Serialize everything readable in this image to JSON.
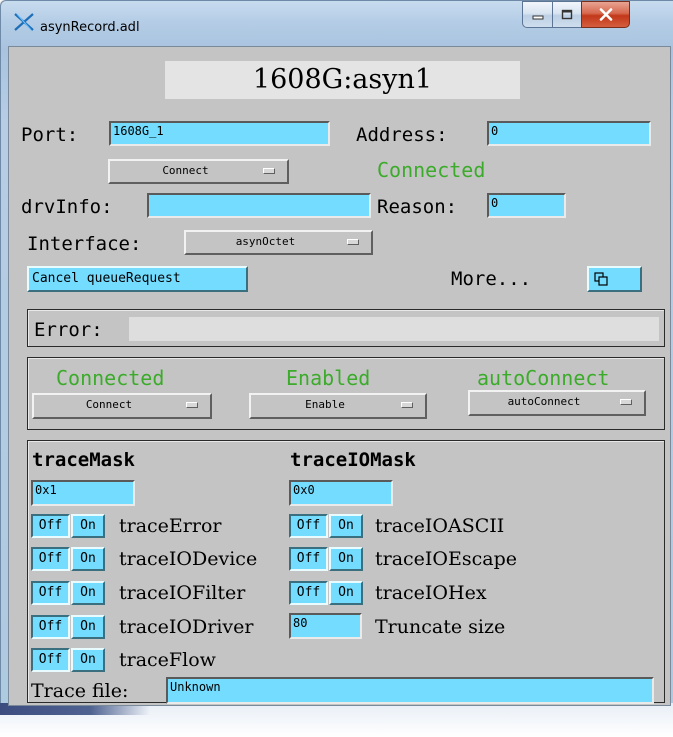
{
  "window": {
    "title": "asynRecord.adl",
    "controls": {
      "minimize": "minimize-icon",
      "maximize": "maximize-icon",
      "close": "close-icon"
    },
    "accent": "#73dcff"
  },
  "record": {
    "name": "1608G:asyn1"
  },
  "port": {
    "label": "Port:",
    "value": "1608G_1"
  },
  "address": {
    "label": "Address:",
    "value": "0"
  },
  "connect_menu": {
    "value": "Connect"
  },
  "connection_status": {
    "text": "Connected",
    "color": "#3cab2b"
  },
  "drvinfo": {
    "label": "drvInfo:",
    "value": ""
  },
  "reason": {
    "label": "Reason:",
    "value": "0"
  },
  "interface": {
    "label": "Interface:",
    "value": "asynOctet"
  },
  "cancel_button": {
    "label": "Cancel queueRequest"
  },
  "more": {
    "label": "More...",
    "icon": "related-display-icon"
  },
  "error": {
    "label": "Error:",
    "value": ""
  },
  "status_panel": {
    "connected": {
      "status": "Connected",
      "menu_value": "Connect"
    },
    "enabled": {
      "status": "Enabled",
      "menu_value": "Enable"
    },
    "autoconnect": {
      "status": "autoConnect",
      "menu_value": "autoConnect"
    }
  },
  "trace": {
    "mask_title": "traceMask",
    "mask_value": "0x1",
    "io_mask_title": "traceIOMask",
    "io_mask_value": "0x0",
    "off_label": "Off",
    "on_label": "On",
    "mask_bits": [
      {
        "label": "traceError",
        "state": "Off"
      },
      {
        "label": "traceIODevice",
        "state": "Off"
      },
      {
        "label": "traceIOFilter",
        "state": "Off"
      },
      {
        "label": "traceIODriver",
        "state": "Off"
      },
      {
        "label": "traceFlow",
        "state": "Off"
      }
    ],
    "io_bits": [
      {
        "label": "traceIOASCII",
        "state": "Off"
      },
      {
        "label": "traceIOEscape",
        "state": "Off"
      },
      {
        "label": "traceIOHex",
        "state": "Off"
      }
    ],
    "truncate": {
      "value": "80",
      "label": "Truncate size"
    },
    "file": {
      "label": "Trace file:",
      "value": "Unknown"
    }
  }
}
